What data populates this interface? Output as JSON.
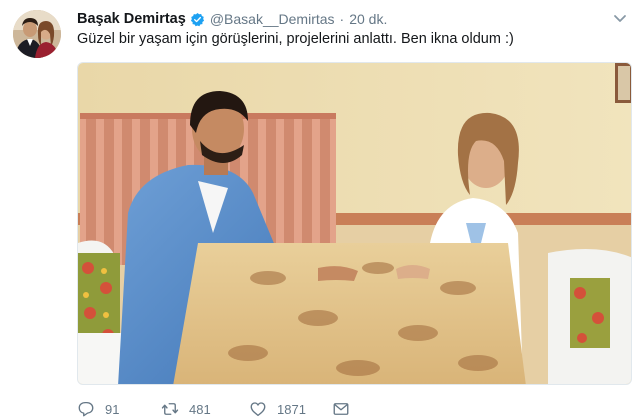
{
  "author": {
    "display_name": "Başak Demirtaş",
    "handle": "@Basak__Demirtas",
    "separator": "·",
    "time": "20 dk.",
    "verified": true,
    "verified_color": "#1da1f2"
  },
  "tweet": {
    "text": "Güzel bir yaşam için görüşlerini, projelerini anlattı. Ben ikna oldum :)"
  },
  "actions": {
    "reply_count": "91",
    "retweet_count": "481",
    "like_count": "1871"
  },
  "icons": {
    "reply": "reply-icon",
    "retweet": "retweet-icon",
    "like": "heart-icon",
    "message": "envelope-icon",
    "menu": "chevron-down-icon"
  },
  "colors": {
    "text": "#14171a",
    "secondary": "#657786",
    "accent": "#1da1f2"
  }
}
